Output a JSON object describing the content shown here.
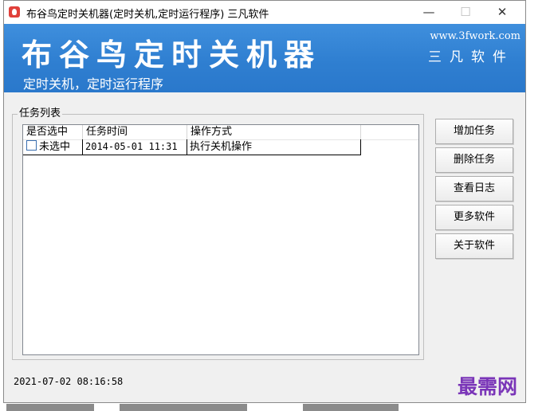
{
  "window": {
    "title": "布谷鸟定时关机器(定时关机,定时运行程序) 三凡软件",
    "minimize": "—",
    "maximize": "☐",
    "close": "✕"
  },
  "banner": {
    "title": "布谷鸟定时关机器",
    "subtitle": "定时关机，定时运行程序",
    "url": "www.3fwork.com",
    "brand": "三凡软件"
  },
  "task_group": {
    "legend": "任务列表",
    "columns": [
      "是否选中",
      "任务时间",
      "操作方式"
    ],
    "rows": [
      {
        "checked": false,
        "select_label": "未选中",
        "time": "2014-05-01 11:31",
        "action": "执行关机操作"
      }
    ]
  },
  "buttons": {
    "add_task": "增加任务",
    "delete_task": "删除任务",
    "view_log": "查看日志",
    "more_software": "更多软件",
    "about": "关于软件"
  },
  "status": {
    "datetime": "2021-07-02 08:16:58"
  },
  "watermark": "最需网",
  "colors": {
    "banner": "#2f7fd1",
    "watermark": "#7a35b8"
  }
}
